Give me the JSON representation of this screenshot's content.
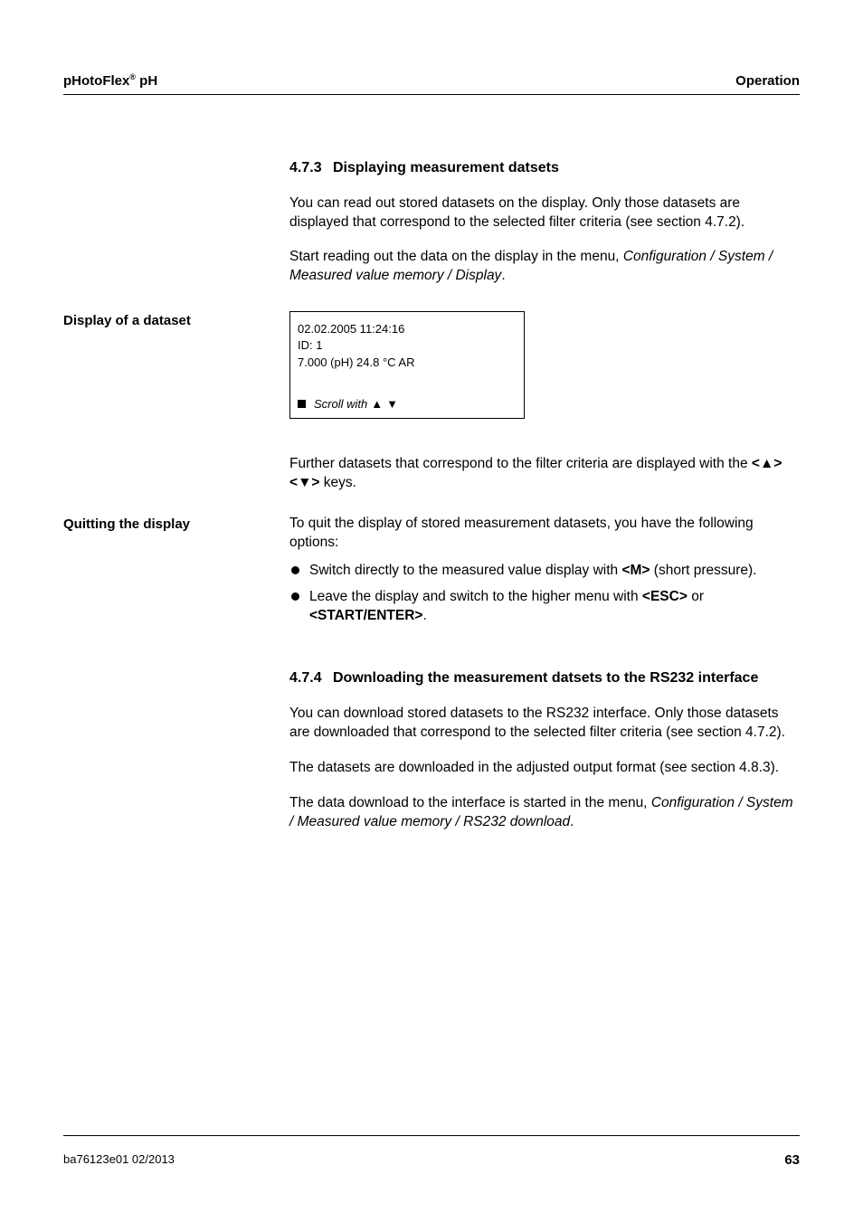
{
  "header": {
    "product_prefix": "pHotoFlex",
    "product_super": "®",
    "product_suffix": " pH",
    "section": "Operation"
  },
  "section473": {
    "num": "4.7.3",
    "title": "Displaying measurement datsets",
    "p1": "You can read out stored datasets on the display. Only those datasets are displayed that correspond to the selected filter criteria (see section 4.7.2).",
    "p2_a": "Start reading out the data on the display in the menu, ",
    "p2_path": "Configuration / System / Measured value memory / Display",
    "p2_c": "."
  },
  "display_block": {
    "label": "Display of a dataset",
    "line1": "02.02.2005  11:24:16",
    "line2": "ID: 1",
    "line3": "7.000 (pH)    24.8 °C  AR",
    "scroll_text": "Scroll with",
    "arrow_up": "▲",
    "arrow_down": "▼"
  },
  "after_box": {
    "p_a": "Further datasets that correspond to the filter criteria are displayed with the ",
    "key_open": "<",
    "key_close": ">",
    "arrow_up_filled": "▲",
    "arrow_down_filled": "▼",
    "p_b": " keys."
  },
  "quitting": {
    "label": "Quitting the display",
    "p1": "To quit the display of stored measurement datasets, you have the following options:",
    "b1_a": "Switch directly to the measured value display with ",
    "b1_key": "<M>",
    "b1_b": " (short pressure).",
    "b2_a": "Leave the display and switch to the higher menu with ",
    "b2_key1": "<ESC>",
    "b2_mid": " or ",
    "b2_key2": "<START/ENTER>",
    "b2_b": "."
  },
  "section474": {
    "num": "4.7.4",
    "title": "Downloading the measurement datsets to the RS232 interface",
    "p1": "You can download stored datasets to the RS232 interface. Only those datasets are downloaded that correspond to the selected filter criteria (see section 4.7.2).",
    "p2": "The datasets are downloaded in the adjusted output format (see section 4.8.3).",
    "p3_a": "The data download to the interface is started in the menu, ",
    "p3_path": "Configuration / System / Measured value memory / RS232 download",
    "p3_b": "."
  },
  "footer": {
    "left": "ba76123e01      02/2013",
    "right": "63"
  }
}
